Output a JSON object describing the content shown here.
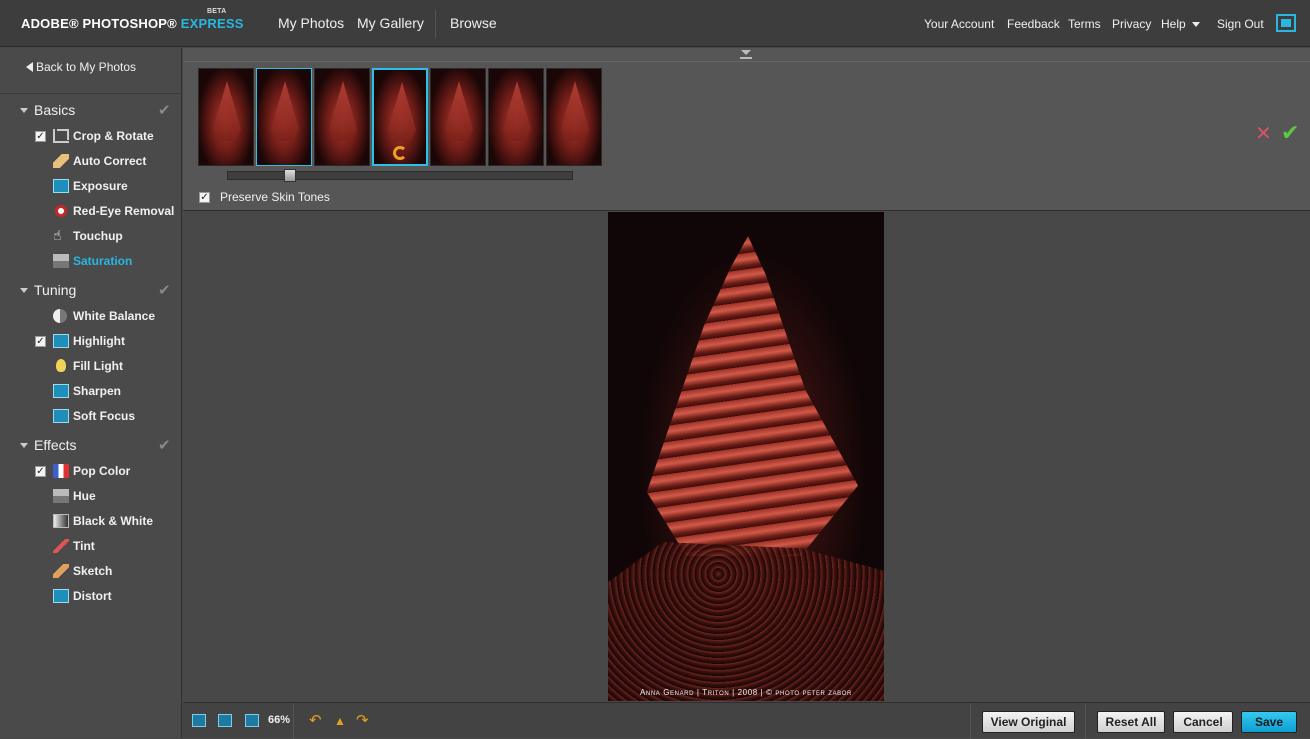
{
  "app": {
    "logo": {
      "adobe": "ADOBE® PHOTOSHOP®",
      "express": "EXPRESS",
      "beta": "BETA"
    },
    "nav": [
      "My Photos",
      "My Gallery",
      "Browse"
    ],
    "top_links": [
      "Your Account",
      "Feedback",
      "Terms",
      "Privacy",
      "Help",
      "Sign Out"
    ]
  },
  "sidebar": {
    "back_label": "Back to My Photos",
    "sections": [
      {
        "title": "Basics",
        "tools": [
          {
            "label": "Crop & Rotate",
            "icon": "crop-icon",
            "checked": true
          },
          {
            "label": "Auto Correct",
            "icon": "auto-correct-icon",
            "checked": false
          },
          {
            "label": "Exposure",
            "icon": "exposure-icon",
            "checked": false
          },
          {
            "label": "Red-Eye Removal",
            "icon": "red-eye-icon",
            "checked": false
          },
          {
            "label": "Touchup",
            "icon": "hand-icon",
            "checked": false
          },
          {
            "label": "Saturation",
            "icon": "saturation-icon",
            "checked": false,
            "active": true
          }
        ]
      },
      {
        "title": "Tuning",
        "tools": [
          {
            "label": "White Balance",
            "icon": "white-balance-icon",
            "checked": false
          },
          {
            "label": "Highlight",
            "icon": "highlight-icon",
            "checked": true
          },
          {
            "label": "Fill Light",
            "icon": "lightbulb-icon",
            "checked": false
          },
          {
            "label": "Sharpen",
            "icon": "sharpen-icon",
            "checked": false
          },
          {
            "label": "Soft Focus",
            "icon": "soft-focus-icon",
            "checked": false
          }
        ]
      },
      {
        "title": "Effects",
        "tools": [
          {
            "label": "Pop Color",
            "icon": "pop-color-icon",
            "checked": true
          },
          {
            "label": "Hue",
            "icon": "hue-icon",
            "checked": false
          },
          {
            "label": "Black & White",
            "icon": "black-white-icon",
            "checked": false
          },
          {
            "label": "Tint",
            "icon": "tint-icon",
            "checked": false
          },
          {
            "label": "Sketch",
            "icon": "sketch-icon",
            "checked": false
          },
          {
            "label": "Distort",
            "icon": "distort-icon",
            "checked": false
          }
        ]
      }
    ]
  },
  "edit_panel": {
    "thumbnail_count": 7,
    "selected_thumbnail": 4,
    "preserve_label": "Preserve Skin Tones",
    "preserve_checked": true,
    "slider_position": 0.17
  },
  "photo": {
    "caption": "Anna Genard | Triton | 2008 | © photo peter zabor"
  },
  "bottom": {
    "zoom": "66%",
    "view_original": "View Original",
    "reset_all": "Reset All",
    "cancel": "Cancel",
    "save": "Save"
  },
  "colors": {
    "accent": "#29b6e0",
    "history": "#e8a020",
    "apply": "#5fc843",
    "discard": "#d45468"
  }
}
